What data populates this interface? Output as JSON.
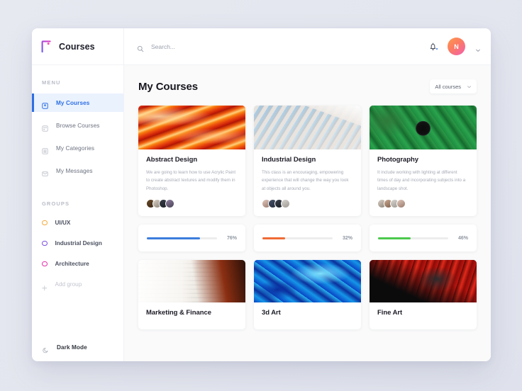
{
  "brand": {
    "title": "Courses",
    "logo_icon": "f-logo-icon"
  },
  "sidebar": {
    "menu_label": "MENU",
    "menu_items": [
      {
        "label": "My Courses",
        "icon": "bookmark-icon",
        "active": true
      },
      {
        "label": "Browse Courses",
        "icon": "grid-icon",
        "active": false
      },
      {
        "label": "My Categories",
        "icon": "folder-icon",
        "active": false
      },
      {
        "label": "My Messages",
        "icon": "mail-icon",
        "active": false
      }
    ],
    "groups_label": "GROUPS",
    "groups": [
      {
        "label": "UI/UX",
        "color": "#f2a93b"
      },
      {
        "label": "Industrial Design",
        "color": "#7b4ee0"
      },
      {
        "label": "Architecture",
        "color": "#e42fa8"
      }
    ],
    "add_group_label": "Add group",
    "dark_mode_label": "Dark Mode"
  },
  "topbar": {
    "search_placeholder": "Search...",
    "search_value": "",
    "avatar_initial": "N",
    "notification_badge": true
  },
  "content": {
    "page_title": "My Courses",
    "filter_label": "All courses",
    "courses": [
      {
        "title": "Abstract Design",
        "description": "We are going to learn how to use Acrylic Paint to create abstract textures and modify them in Photoshop.",
        "image": "abstract",
        "avatars": [
          "f1",
          "f2",
          "f3",
          "f4"
        ]
      },
      {
        "title": "Industrial Design",
        "description": "This class is an encouraging, empowering experience that will change the way you look at objects all around you.",
        "image": "industrial",
        "avatars": [
          "f5",
          "f6",
          "f3",
          "f8"
        ]
      },
      {
        "title": "Photography",
        "description": "It include working with lighting at different times of day  and incorporating subjects into a landscape shot.",
        "image": "photo",
        "avatars": [
          "f2",
          "f7",
          "f8",
          "f5"
        ]
      }
    ],
    "progress": [
      {
        "percent_label": "76%",
        "value": 76,
        "color": "#3b7ddd"
      },
      {
        "percent_label": "32%",
        "value": 32,
        "color": "#ef6b35"
      },
      {
        "percent_label": "46%",
        "value": 46,
        "color": "#4cc94c"
      }
    ],
    "bottom_courses": [
      {
        "title": "Marketing & Finance",
        "image": "marketing"
      },
      {
        "title": "3d Art",
        "image": "3dart"
      },
      {
        "title": "Fine Art",
        "image": "fineart"
      }
    ]
  }
}
